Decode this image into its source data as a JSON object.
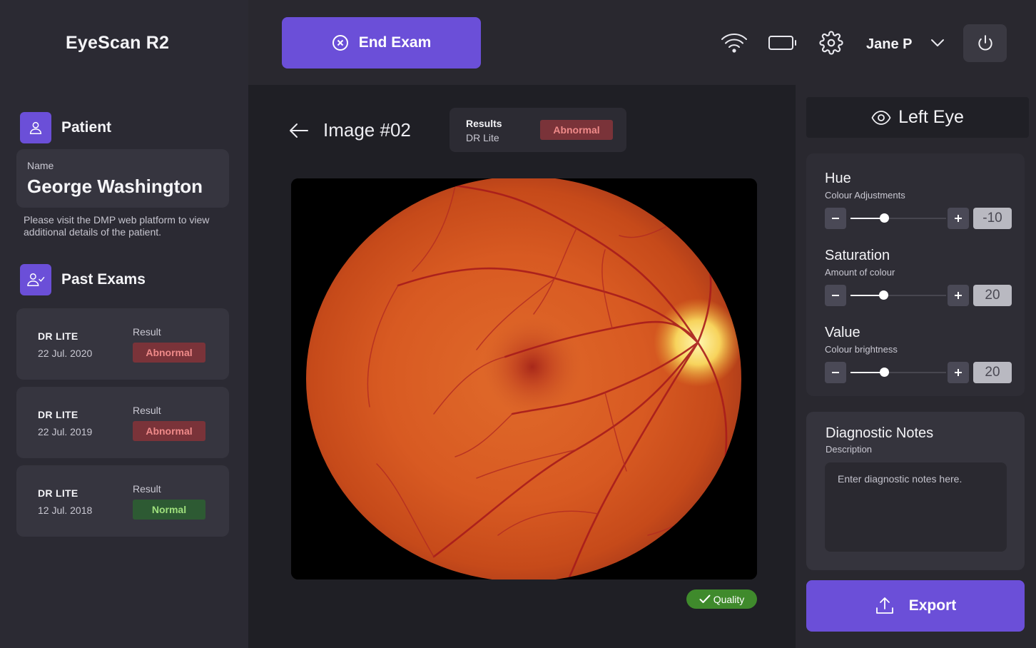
{
  "app": {
    "title": "EyeScan R2"
  },
  "topbar": {
    "end_exam_label": "End Exam",
    "user_name": "Jane P",
    "icons": [
      "wifi-icon",
      "battery-icon",
      "gear-icon",
      "chevron-down-icon",
      "power-icon"
    ]
  },
  "sidebar": {
    "patient": {
      "heading": "Patient",
      "name_caption": "Name",
      "name": "George Washington",
      "note": "Please visit the DMP web platform to view additional details of the patient."
    },
    "past_exams": {
      "heading": "Past Exams",
      "items": [
        {
          "type": "DR LITE",
          "date": "22 Jul. 2020",
          "result_label": "Result",
          "result": "Abnormal",
          "status": "abnormal"
        },
        {
          "type": "DR LITE",
          "date": "22 Jul. 2019",
          "result_label": "Result",
          "result": "Abnormal",
          "status": "abnormal"
        },
        {
          "type": "DR LITE",
          "date": "12 Jul. 2018",
          "result_label": "Result",
          "result": "Normal",
          "status": "normal"
        }
      ]
    }
  },
  "main": {
    "image_title": "Image #02",
    "results": {
      "label": "Results",
      "model": "DR Lite",
      "status": "Abnormal"
    },
    "quality_label": "Quality"
  },
  "panel": {
    "eye_label": "Left Eye",
    "adjustments": [
      {
        "title": "Hue",
        "subtitle": "Colour Adjustments",
        "value": "-10",
        "level": 0.35
      },
      {
        "title": "Saturation",
        "subtitle": "Amount of colour",
        "value": "20",
        "level": 0.34
      },
      {
        "title": "Value",
        "subtitle": "Colour brightness",
        "value": "20",
        "level": 0.35
      }
    ],
    "notes": {
      "title": "Diagnostic Notes",
      "subtitle": "Description",
      "placeholder": "Enter diagnostic notes here."
    },
    "export_label": "Export"
  },
  "colors": {
    "accent": "#6b4fd8",
    "abnormal_bg": "#7a3339",
    "abnormal_text": "#ef8a89",
    "normal_bg": "#2d5a33",
    "normal_text": "#9fe07d",
    "quality": "#3f8a2c"
  }
}
